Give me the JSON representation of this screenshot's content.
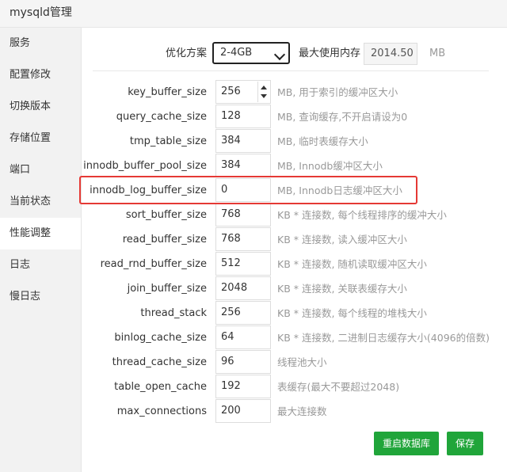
{
  "window": {
    "title": "mysqld管理"
  },
  "sidebar": {
    "items": [
      {
        "label": "服务"
      },
      {
        "label": "配置修改"
      },
      {
        "label": "切换版本"
      },
      {
        "label": "存储位置"
      },
      {
        "label": "端口"
      },
      {
        "label": "当前状态"
      },
      {
        "label": "性能调整",
        "active": true
      },
      {
        "label": "日志"
      },
      {
        "label": "慢日志"
      }
    ]
  },
  "top": {
    "plan_label": "优化方案",
    "plan_selected": "2-4GB",
    "maxmem_label": "最大使用内存",
    "maxmem_value": "2014.50",
    "maxmem_unit": "MB"
  },
  "params": [
    {
      "name": "key_buffer_size",
      "value": "256",
      "desc": "MB, 用于索引的缓冲区大小"
    },
    {
      "name": "query_cache_size",
      "value": "128",
      "desc": "MB, 查询缓存,不开启请设为0"
    },
    {
      "name": "tmp_table_size",
      "value": "384",
      "desc": "MB, 临时表缓存大小"
    },
    {
      "name": "innodb_buffer_pool_size",
      "value": "384",
      "desc": "MB, Innodb缓冲区大小"
    },
    {
      "name": "innodb_log_buffer_size",
      "value": "0",
      "desc": "MB, Innodb日志缓冲区大小"
    },
    {
      "name": "sort_buffer_size",
      "value": "768",
      "desc": "KB * 连接数, 每个线程排序的缓冲大小"
    },
    {
      "name": "read_buffer_size",
      "value": "768",
      "desc": "KB * 连接数, 读入缓冲区大小"
    },
    {
      "name": "read_rnd_buffer_size",
      "value": "512",
      "desc": "KB * 连接数, 随机读取缓冲区大小"
    },
    {
      "name": "join_buffer_size",
      "value": "2048",
      "desc": "KB * 连接数, 关联表缓存大小"
    },
    {
      "name": "thread_stack",
      "value": "256",
      "desc": "KB * 连接数, 每个线程的堆栈大小"
    },
    {
      "name": "binlog_cache_size",
      "value": "64",
      "desc": "KB * 连接数, 二进制日志缓存大小(4096的倍数)"
    },
    {
      "name": "thread_cache_size",
      "value": "96",
      "desc": "线程池大小"
    },
    {
      "name": "table_open_cache",
      "value": "192",
      "desc": "表缓存(最大不要超过2048)"
    },
    {
      "name": "max_connections",
      "value": "200",
      "desc": "最大连接数"
    }
  ],
  "buttons": {
    "restart": "重启数据库",
    "save": "保存"
  },
  "colors": {
    "accent": "#20a53a",
    "highlight": "#e53935"
  }
}
